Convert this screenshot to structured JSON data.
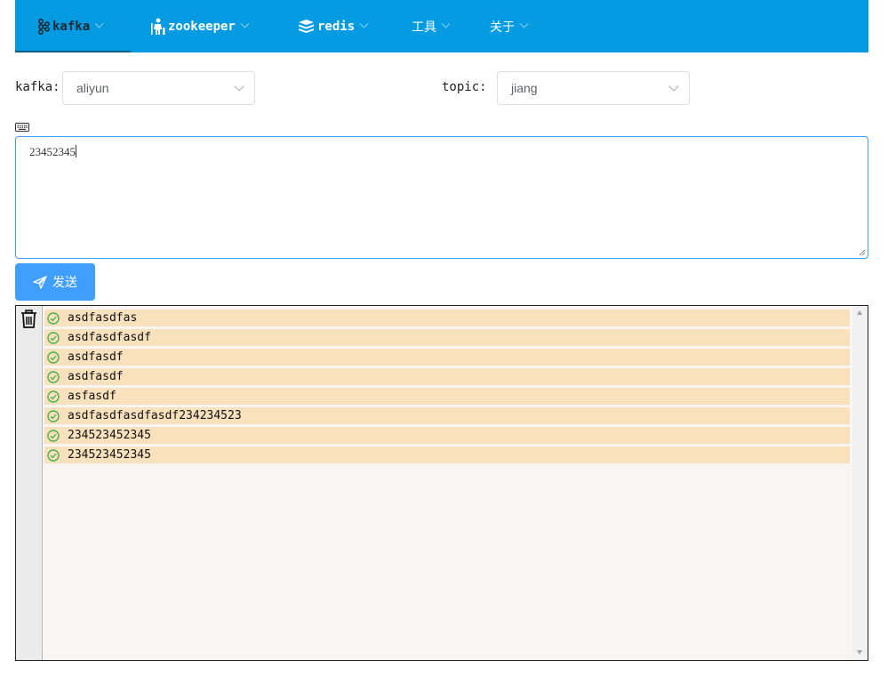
{
  "nav": {
    "items": [
      {
        "label": "kafka",
        "icon": "kafka-icon",
        "active": true
      },
      {
        "label": "zookeeper",
        "icon": "zookeeper-icon",
        "active": false
      },
      {
        "label": "redis",
        "icon": "redis-icon",
        "active": false
      },
      {
        "label": "工具",
        "icon": "",
        "active": false
      },
      {
        "label": "关于",
        "icon": "",
        "active": false
      }
    ]
  },
  "form": {
    "kafka_label": "kafka:",
    "kafka_value": "aliyun",
    "topic_label": "topic:",
    "topic_value": "jiang",
    "message_value": "23452345",
    "send_label": "发送"
  },
  "log": {
    "messages": [
      "asdfasdfas",
      "asdfasdfasdf",
      "asdfasdf",
      "asdfasdf",
      "asfasdf",
      "asdfasdfasdfasdf234234523",
      "234523452345",
      "234523452345"
    ]
  },
  "colors": {
    "navbar": "#049be3",
    "primary": "#409eff",
    "row_highlight": "#f8e1bd",
    "success": "#4caf50"
  }
}
